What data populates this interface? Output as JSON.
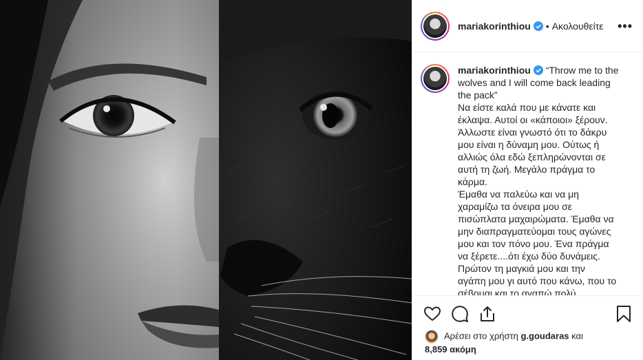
{
  "post": {
    "author": "mariakorinthiou",
    "header_separator": "•",
    "follow_label": "Ακολουθείτε",
    "more_label": "•••",
    "caption_lines": [
      "“Throw me to the",
      "wolves and I will come back leading",
      "the pack”",
      "Να είστε καλά που με κάνατε και",
      "έκλαψα. Αυτοί οι «κάποιοι» ξέρουν.",
      "Άλλωστε είναι γνωστό ότι το δάκρυ",
      "μου είναι η δύναμη μου. Ούτως ή",
      "αλλιώς όλα εδώ ξεπληρώνονται σε",
      "αυτή τη ζωή. Μεγάλο πράγμα το",
      "κάρμα.",
      "Έμαθα να παλεύω και να μη",
      "χαραμίζω τα όνειρα μου σε",
      "πισώπλατα μαχαιρώματα. Έμαθα να",
      "μην διαπραγματεύομαι τους αγώνες",
      "μου και τον πόνο μου. Ένα πράγμα",
      "να ξέρετε....ότι έχω δύο δυνάμεις.",
      "Πρώτον τη μαγκιά μου και την",
      "αγάπη μου γι αυτό που κάνω, που το",
      "σέβομαι και το αγαπώ πολύ"
    ],
    "likes": {
      "prefix": "Αρέσει στο χρήστη",
      "user": "g.goudaras",
      "connector": "και",
      "count": "8,859",
      "suffix": "ακόμη"
    }
  },
  "icons": {
    "like": "heart-icon",
    "comment": "comment-icon",
    "share": "share-icon",
    "save": "bookmark-icon",
    "verified": "verified-badge-icon"
  },
  "colors": {
    "text": "#262626",
    "verified": "#3897f0",
    "border": "#efefef"
  }
}
